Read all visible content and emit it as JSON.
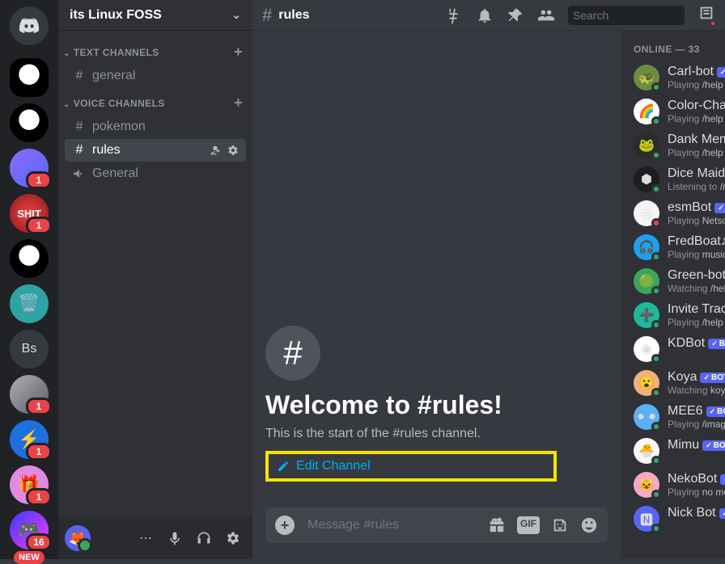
{
  "guild": {
    "name": "its Linux FOSS"
  },
  "server_rail": {
    "new_label": "NEW",
    "badges": {
      "s3": "1",
      "s4": "1",
      "s7": "1",
      "s8": "1",
      "s9": "1",
      "s10": "16"
    }
  },
  "categories": {
    "text": {
      "label": "TEXT CHANNELS"
    },
    "voice": {
      "label": "VOICE CHANNELS"
    }
  },
  "channels": {
    "general": "general",
    "pokemon": "pokemon",
    "rules": "rules",
    "voice_general": "General"
  },
  "header": {
    "current_channel": "rules",
    "search_placeholder": "Search"
  },
  "welcome": {
    "title": "Welcome to #rules!",
    "subtitle": "This is the start of the #rules channel.",
    "edit": "Edit Channel"
  },
  "composer": {
    "placeholder": "Message #rules",
    "gif": "GIF"
  },
  "members_header": "ONLINE — 33",
  "bot_tag": "BOT",
  "members": [
    {
      "name": "Carl-bot",
      "activity_prefix": "Playing ",
      "activity": "/help | carl.gg",
      "status": "online",
      "emoji": "🐢",
      "avbg": "#6c8d3f"
    },
    {
      "name": "Color-Chan",
      "activity_prefix": "Playing ",
      "activity": "/help",
      "status": "online",
      "emoji": "🌈",
      "avbg": "#ffffff"
    },
    {
      "name": "Dank Memer",
      "activity_prefix": "Playing ",
      "activity": "/help",
      "status": "online",
      "emoji": "🐸",
      "avbg": "#2b2b2b"
    },
    {
      "name": "Dice Maiden",
      "activity_prefix": "Listening to ",
      "activity": "/roll",
      "status": "online",
      "emoji": "⬢",
      "avbg": "#1e1e1e"
    },
    {
      "name": "esmBot",
      "activity_prefix": "Playing ",
      "activity": "Netscape Navigator",
      "status": "dnd",
      "emoji": "◎",
      "avbg": "#f5f5f5"
    },
    {
      "name": "FredBoat♪♪",
      "activity_prefix": "Playing ",
      "activity": "music | /help",
      "status": "online",
      "emoji": "🎧",
      "avbg": "#1da1f2"
    },
    {
      "name": "Green-bot",
      "activity_prefix": "Watching ",
      "activity": "/help | green-bot.",
      "status": "online",
      "emoji": "🟢",
      "avbg": "#3ba55d"
    },
    {
      "name": "Invite Tracker",
      "activity_prefix": "Playing ",
      "activity": "/help | docs.invite-t",
      "status": "online",
      "emoji": "➕",
      "avbg": "#1abc9c"
    },
    {
      "name": "KDBot",
      "activity_prefix": "",
      "activity": "",
      "status": "online",
      "emoji": "◉",
      "avbg": "#ffffff"
    },
    {
      "name": "Koya",
      "activity_prefix": "Watching ",
      "activity": "koya.gg",
      "status": "online",
      "emoji": "😮",
      "avbg": "#f0b27a"
    },
    {
      "name": "MEE6",
      "activity_prefix": "Playing ",
      "activity": "/imagine",
      "status": "online",
      "emoji": "● ●",
      "avbg": "#59b0f6"
    },
    {
      "name": "Mimu",
      "activity_prefix": "",
      "activity": "",
      "status": "online",
      "emoji": "🐣",
      "avbg": "#f8f8f8"
    },
    {
      "name": "NekoBot",
      "activity_prefix": "Playing ",
      "activity": "no message intent s",
      "status": "online",
      "emoji": "😺",
      "avbg": "#f5a9c4"
    },
    {
      "name": "Nick Bot",
      "activity_prefix": "",
      "activity": "",
      "status": "online",
      "emoji": "🅽",
      "avbg": "#5865f2"
    }
  ]
}
